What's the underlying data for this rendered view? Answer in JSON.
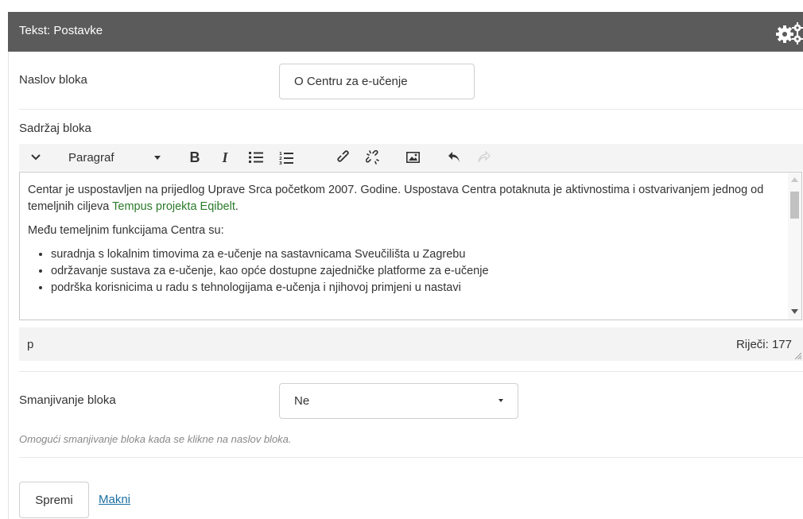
{
  "panel": {
    "title": "Tekst: Postavke"
  },
  "block_title": {
    "label": "Naslov bloka",
    "value": "O Centru za e-učenje"
  },
  "block_content": {
    "label": "Sadržaj bloka",
    "toolbar": {
      "format_label": "Paragraf"
    },
    "paragraph1": "Centar je uspostavljen na prijedlog Uprave Srca početkom 2007. Godine. Uspostava Centra potaknuta je aktivnostima i ostvarivanjem jednog od temeljnih ciljeva ",
    "link_text": "Tempus projekta Eqibelt",
    "paragraph1_end": ".",
    "paragraph2": "Među temeljnim funkcijama Centra su:",
    "bullets": [
      "suradnja s lokalnim timovima za e-učenje na sastavnicama Sveučilišta u Zagrebu",
      "održavanje sustava za e-učenje, kao opće dostupne zajedničke platforme za e-učenje",
      "podrška korisnicima u radu s tehnologijama e-učenja i njihovoj primjeni u nastavi"
    ],
    "status_path": "p",
    "word_count_label": "Riječi: 177"
  },
  "collapse": {
    "label": "Smanjivanje bloka",
    "selected": "Ne",
    "help": "Omogući smanjivanje bloka kada se klikne na naslov bloka."
  },
  "actions": {
    "save_label": "Spremi",
    "remove_label": "Makni"
  }
}
